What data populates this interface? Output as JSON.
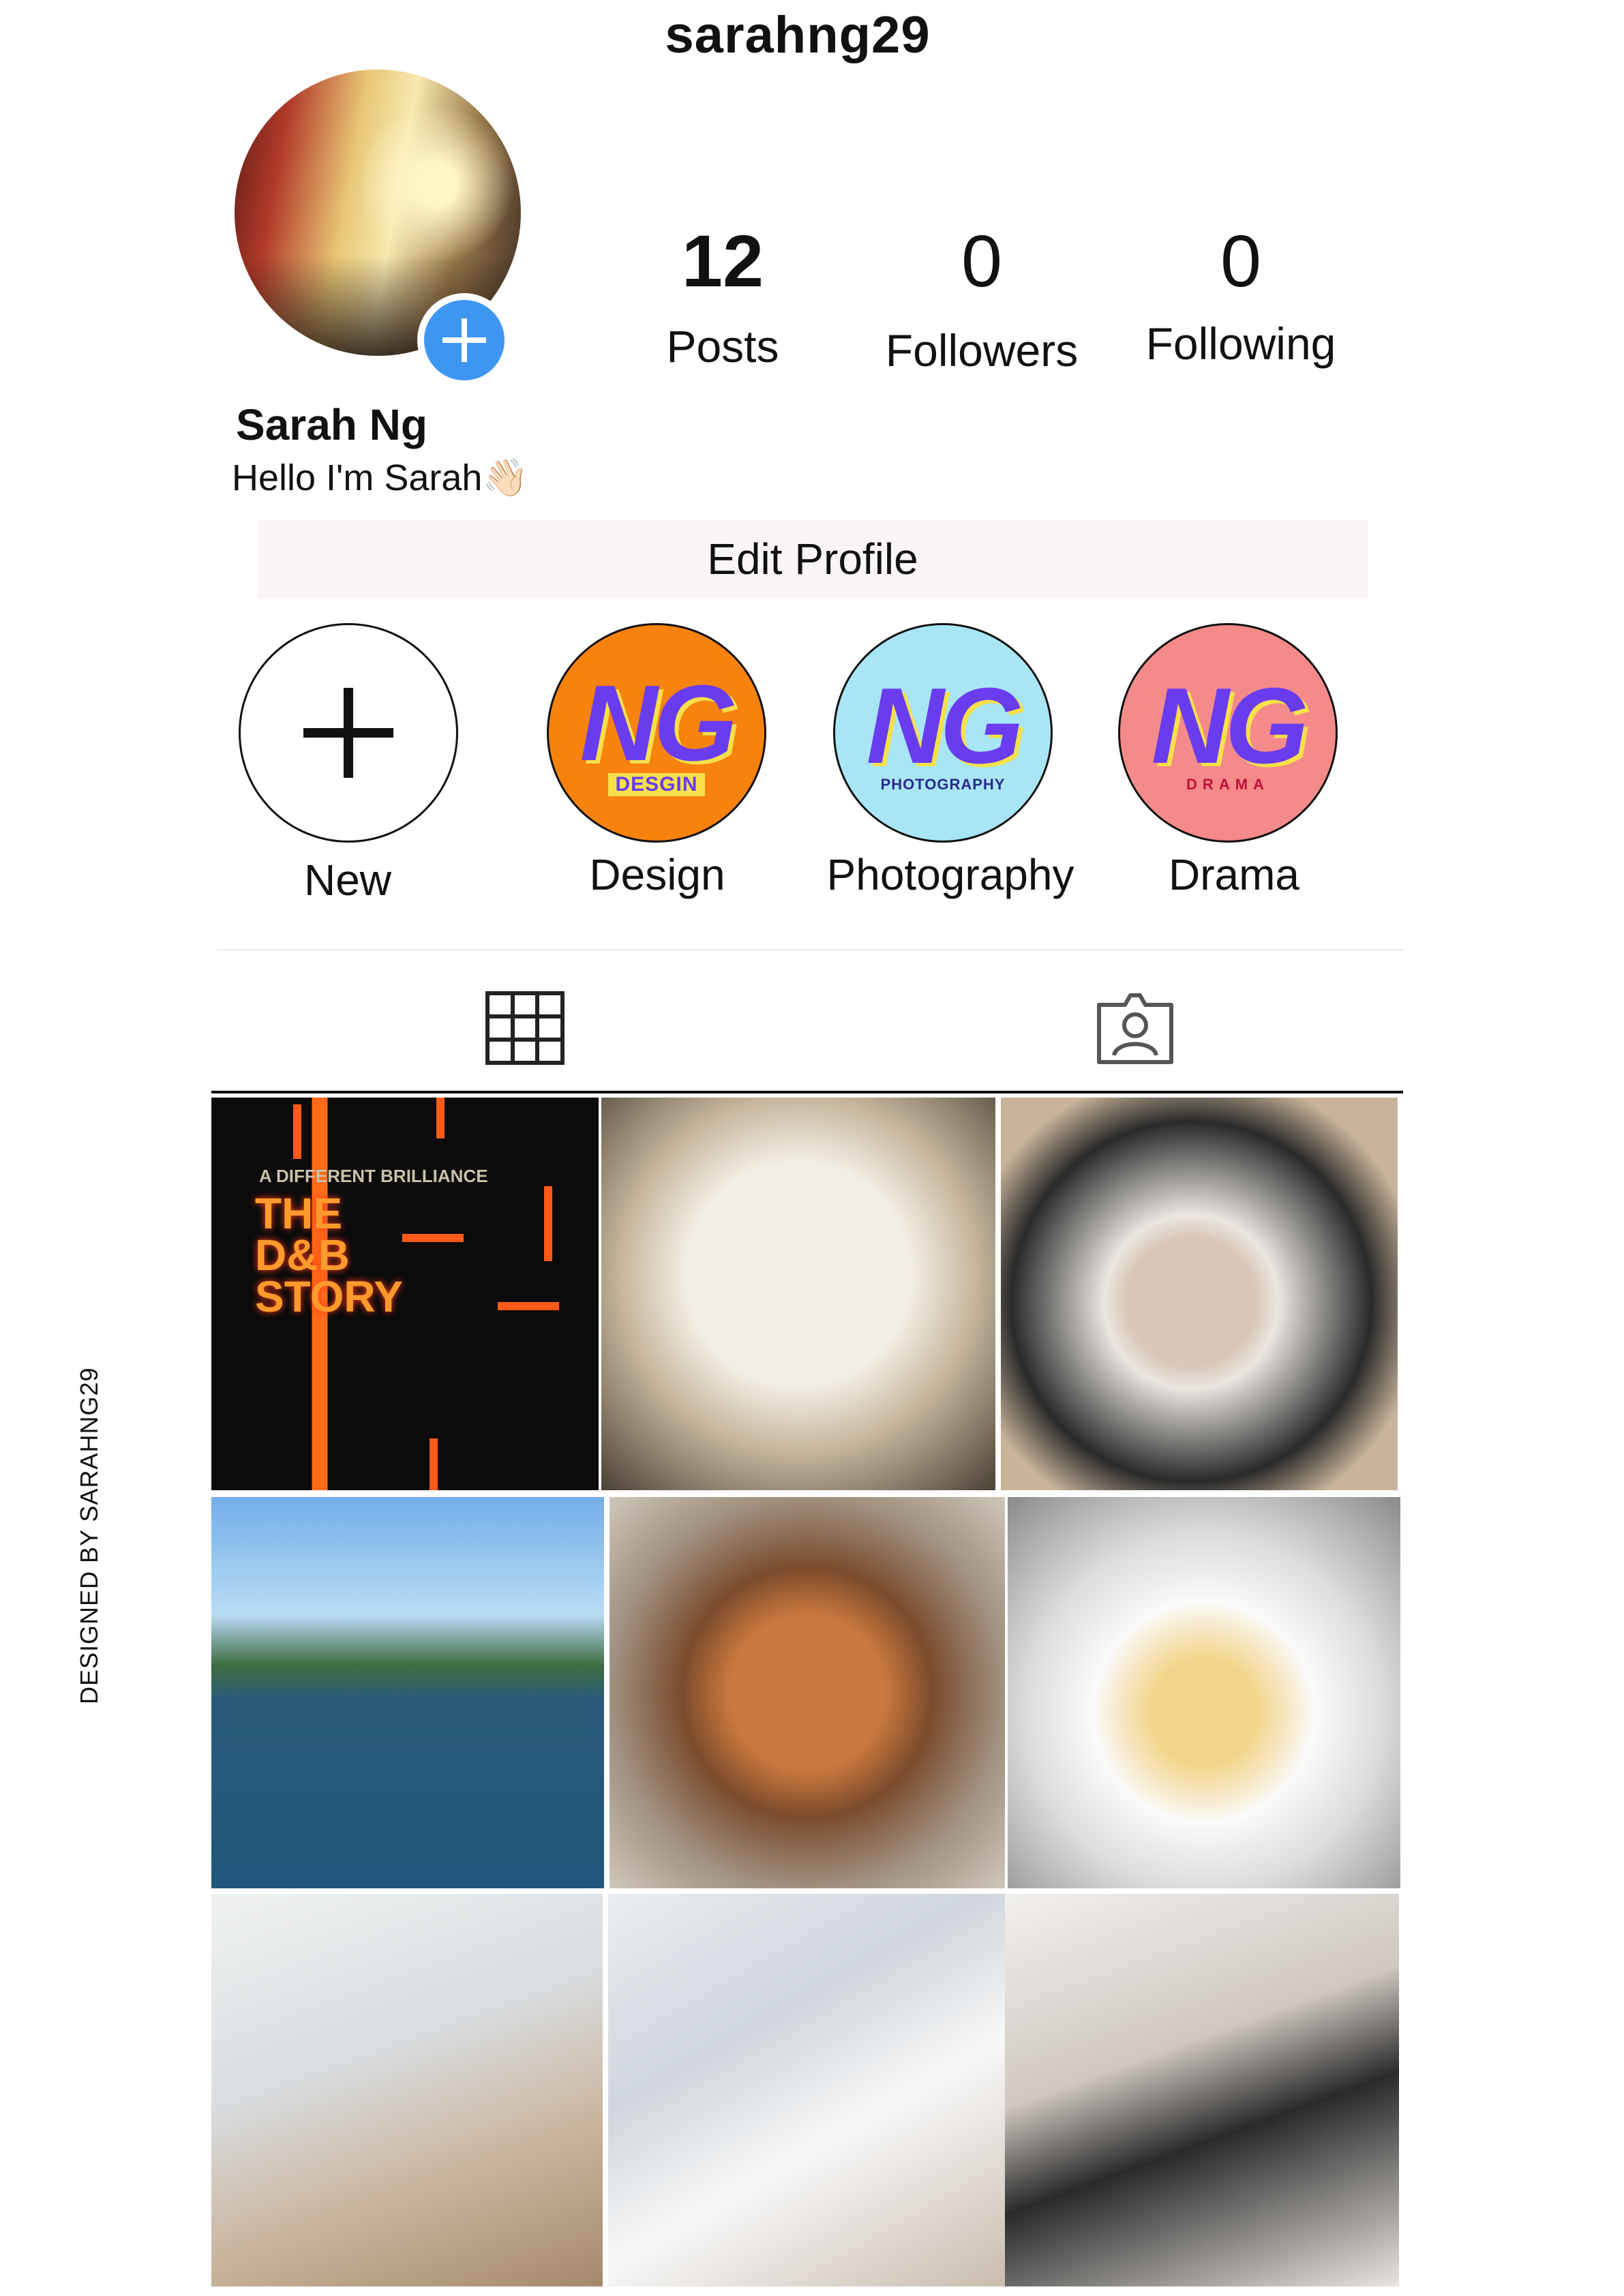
{
  "profile": {
    "username": "sarahng29",
    "name": "Sarah Ng",
    "bio": "Hello I'm Sarah👋🏻",
    "edit_button": "Edit Profile"
  },
  "stats": [
    {
      "value": "12",
      "label": "Posts"
    },
    {
      "value": "0",
      "label": "Followers"
    },
    {
      "value": "0",
      "label": "Following"
    }
  ],
  "highlights": [
    {
      "label": "New",
      "icon": "plus-icon"
    },
    {
      "label": "Design",
      "logo": "NG",
      "sub": "DESGIN",
      "bg": "#f7820e"
    },
    {
      "label": "Photography",
      "logo": "NG",
      "sub": "PHOTOGRAPHY",
      "bg": "#a8e6f6"
    },
    {
      "label": "Drama",
      "logo": "NG",
      "sub": "DRAMA",
      "bg": "#f58a8a"
    }
  ],
  "tabs": [
    {
      "name": "grid",
      "icon": "grid-icon",
      "selected": true
    },
    {
      "name": "tagged",
      "icon": "tagged-person-icon",
      "selected": false
    }
  ],
  "posts": [
    {
      "text": "A DIFFERENT BRILLIANCE",
      "title": "THE D&B STORY"
    },
    {},
    {},
    {},
    {},
    {},
    {},
    {},
    {}
  ],
  "side_caption": "DESIGNED BY SARAHNG29",
  "colors": {
    "accent_blue": "#3d97f0",
    "edit_button_bg": "#faf6f5",
    "ng_purple": "#6a3cf0"
  }
}
